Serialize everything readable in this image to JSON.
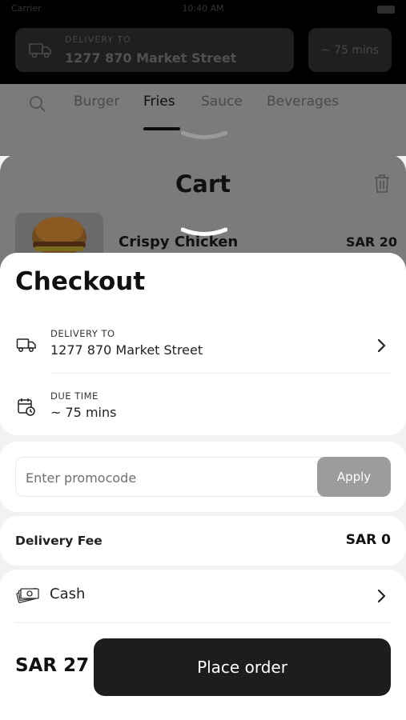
{
  "status_bar": {
    "carrier": "Carrier",
    "time": "10:40 AM"
  },
  "header": {
    "delivery_label": "DELIVERY TO",
    "delivery_address": "1277 870 Market Street",
    "eta": "~ 75 mins"
  },
  "categories": [
    "Burger",
    "Fries",
    "Sauce",
    "Beverages"
  ],
  "active_category": "Fries",
  "cart": {
    "title": "Cart",
    "item_name": "Crispy Chicken",
    "item_price": "SAR 20"
  },
  "checkout": {
    "title": "Checkout",
    "delivery": {
      "label": "DELIVERY TO",
      "value": "1277 870 Market Street"
    },
    "due_time": {
      "label": "DUE TIME",
      "value": "~ 75 mins"
    },
    "promo": {
      "placeholder": "Enter promocode",
      "apply_label": "Apply"
    },
    "delivery_fee": {
      "label": "Delivery Fee",
      "value": "SAR 0"
    },
    "payment": {
      "method": "Cash"
    },
    "total": "SAR 27",
    "place_order_label": "Place order"
  },
  "icons": {
    "truck": "truck-icon",
    "calendar_clock": "calendar-clock-icon",
    "cash": "cash-icon",
    "chevron": "chevron-right-icon",
    "search": "search-icon",
    "trash": "trash-icon"
  }
}
